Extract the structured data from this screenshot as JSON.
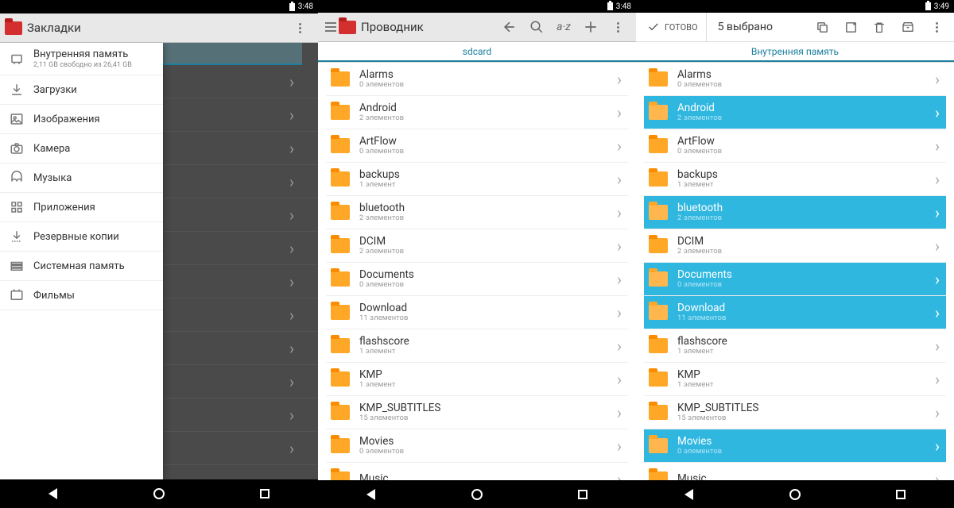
{
  "status": {
    "time1": "3:48",
    "time2": "3:48",
    "time3": "3:49"
  },
  "pane1": {
    "title": "Закладки",
    "sidebar": [
      {
        "label": "Внутренняя память",
        "sub": "2,11 GB свободно из 26,41 GB",
        "icon": "storage"
      },
      {
        "label": "Загрузки",
        "icon": "download"
      },
      {
        "label": "Изображения",
        "icon": "image"
      },
      {
        "label": "Камера",
        "icon": "camera"
      },
      {
        "label": "Музыка",
        "icon": "music"
      },
      {
        "label": "Приложения",
        "icon": "apps"
      },
      {
        "label": "Резервные копии",
        "icon": "backup"
      },
      {
        "label": "Системная память",
        "icon": "system"
      },
      {
        "label": "Фильмы",
        "icon": "movies"
      }
    ]
  },
  "pane2": {
    "title": "Проводник",
    "crumb": "sdcard",
    "items": [
      {
        "name": "Alarms",
        "sub": "0 элементов"
      },
      {
        "name": "Android",
        "sub": "2 элементов"
      },
      {
        "name": "ArtFlow",
        "sub": "0 элементов"
      },
      {
        "name": "backups",
        "sub": "1 элемент"
      },
      {
        "name": "bluetooth",
        "sub": "2 элементов"
      },
      {
        "name": "DCIM",
        "sub": "2 элементов"
      },
      {
        "name": "Documents",
        "sub": "0 элементов"
      },
      {
        "name": "Download",
        "sub": "11 элементов"
      },
      {
        "name": "flashscore",
        "sub": "1 элемент"
      },
      {
        "name": "KMP",
        "sub": "1 элемент"
      },
      {
        "name": "KMP_SUBTITLES",
        "sub": "15 элементов"
      },
      {
        "name": "Movies",
        "sub": "0 элементов"
      },
      {
        "name": "Music",
        "sub": ""
      }
    ]
  },
  "pane3": {
    "done": "ГОТОВО",
    "count": "5 выбрано",
    "crumb": "Внутренняя память",
    "items": [
      {
        "name": "Alarms",
        "sub": "0 элементов",
        "sel": false
      },
      {
        "name": "Android",
        "sub": "2 элементов",
        "sel": true
      },
      {
        "name": "ArtFlow",
        "sub": "0 элементов",
        "sel": false
      },
      {
        "name": "backups",
        "sub": "1 элемент",
        "sel": false
      },
      {
        "name": "bluetooth",
        "sub": "2 элементов",
        "sel": true
      },
      {
        "name": "DCIM",
        "sub": "2 элементов",
        "sel": false
      },
      {
        "name": "Documents",
        "sub": "0 элементов",
        "sel": true
      },
      {
        "name": "Download",
        "sub": "11 элементов",
        "sel": true
      },
      {
        "name": "flashscore",
        "sub": "1 элемент",
        "sel": false
      },
      {
        "name": "KMP",
        "sub": "1 элемент",
        "sel": false
      },
      {
        "name": "KMP_SUBTITLES",
        "sub": "15 элементов",
        "sel": false
      },
      {
        "name": "Movies",
        "sub": "0 элементов",
        "sel": true
      },
      {
        "name": "Music",
        "sub": "",
        "sel": false
      }
    ]
  }
}
